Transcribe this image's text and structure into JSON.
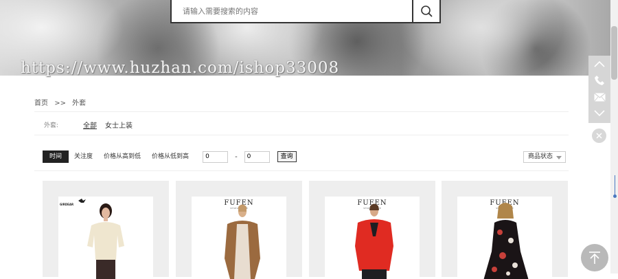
{
  "header": {
    "search_placeholder": "请输入需要搜索的内容",
    "search_icon": "search-icon",
    "watermark": "https://www.huzhan.com/ishop33008"
  },
  "breadcrumb": {
    "home": "首页",
    "separator": ">>",
    "current": "外套"
  },
  "filter": {
    "label": "外套:",
    "options": [
      "全部",
      "女士上装"
    ]
  },
  "sortbar": {
    "items": [
      "时间",
      "关注度",
      "价格从高到低",
      "价格从低到高"
    ],
    "price_min": "0",
    "price_dash": "-",
    "price_max": "0",
    "query_label": "查询",
    "status_label": "商品状态"
  },
  "products": [
    {
      "brand": "GIRDEAR",
      "brand_sub": "",
      "top_color": "#efe6cf",
      "bottom_color": "#3a2a28"
    },
    {
      "brand": "FUFEN",
      "brand_sub": "STYLE & PRIVATE",
      "top_color": "#9b6a3f",
      "bottom_color": "#e8ddd0"
    },
    {
      "brand": "FUFEN",
      "brand_sub": "STYLE & PRIVATE",
      "top_color": "#e02b22",
      "bottom_color": "#1e1e22"
    },
    {
      "brand": "FUFEN",
      "brand_sub": "STYLE & PRIVATE",
      "top_color": "#1a1416",
      "bottom_color": "#1a1416"
    }
  ],
  "side_tools": [
    "chevron-up-icon",
    "phone-icon",
    "mail-icon",
    "chevron-down-icon"
  ],
  "colors": {
    "active_sort_bg": "#222222",
    "card_bg": "#eeeeee",
    "side_tools_bg": "#d6d6d6"
  }
}
